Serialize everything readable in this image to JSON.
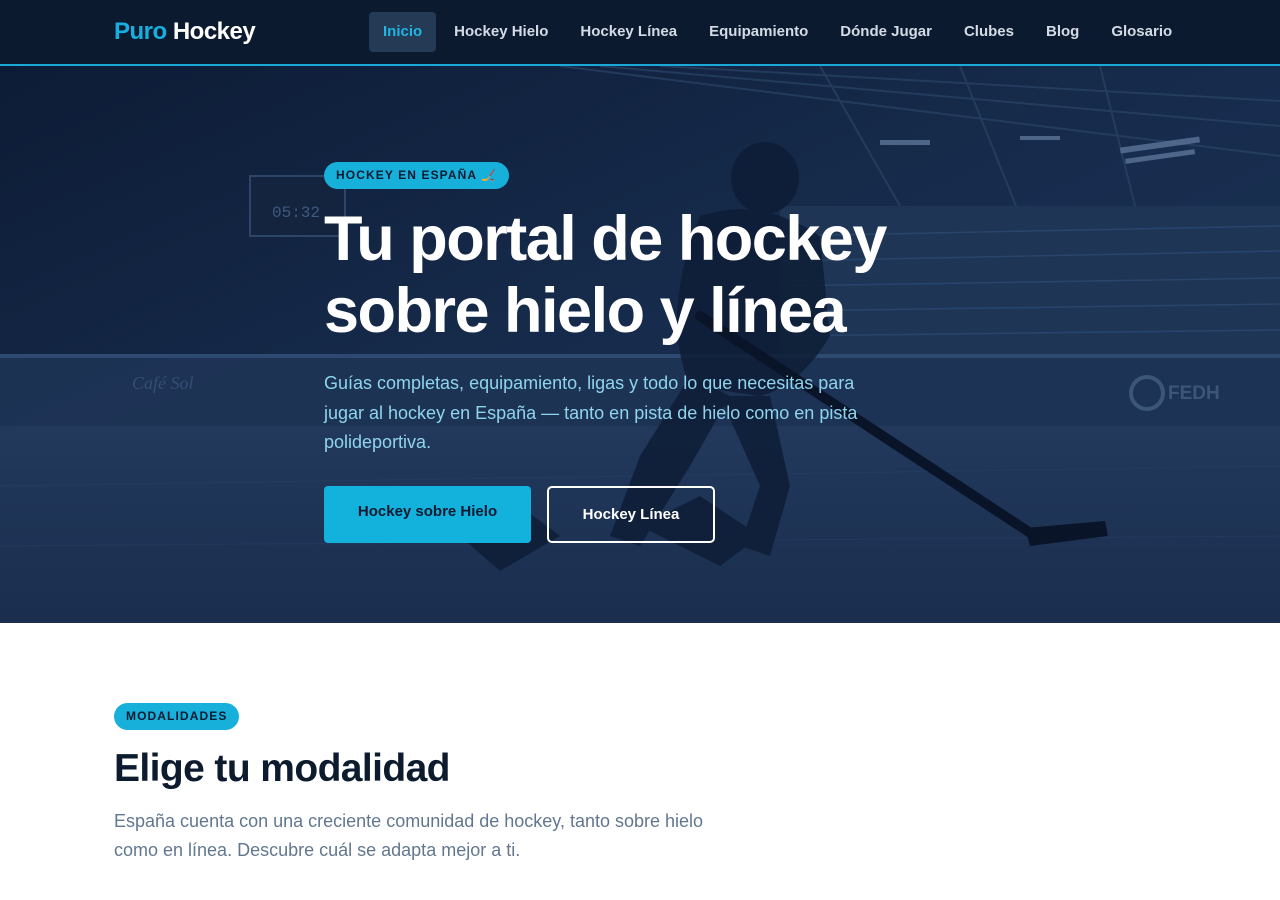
{
  "nav": {
    "logo_part1": "Puro",
    "logo_part2": "Hockey",
    "items": [
      {
        "label": "Inicio",
        "active": true
      },
      {
        "label": "Hockey Hielo",
        "active": false
      },
      {
        "label": "Hockey Línea",
        "active": false
      },
      {
        "label": "Equipamiento",
        "active": false
      },
      {
        "label": "Dónde Jugar",
        "active": false
      },
      {
        "label": "Clubes",
        "active": false
      },
      {
        "label": "Blog",
        "active": false
      },
      {
        "label": "Glosario",
        "active": false
      }
    ]
  },
  "hero": {
    "tag": "HOCKEY EN ESPAÑA 🏒",
    "title": "Tu portal de hockey sobre hielo y línea",
    "subtitle": "Guías completas, equipamiento, ligas y todo lo que necesitas para jugar al hockey en España — tanto en pista de hielo como en pista polideportiva.",
    "primary_button": "Hockey sobre Hielo",
    "secondary_button": "Hockey Línea",
    "background_signs": {
      "scoreboard": "05:32",
      "left_sign": "Café Sol",
      "right_logo": "FEDH"
    }
  },
  "section": {
    "tag": "MODALIDADES",
    "title": "Elige tu modalidad",
    "description": "España cuenta con una creciente comunidad de hockey, tanto sobre hielo como en línea. Descubre cuál se adapta mejor a ti."
  },
  "colors": {
    "nav_bg": "#0c1a30",
    "accent": "#17b0db",
    "hero_overlay": "#15294a",
    "heading_dark": "#0d1b2e",
    "body_text": "#62778f"
  }
}
